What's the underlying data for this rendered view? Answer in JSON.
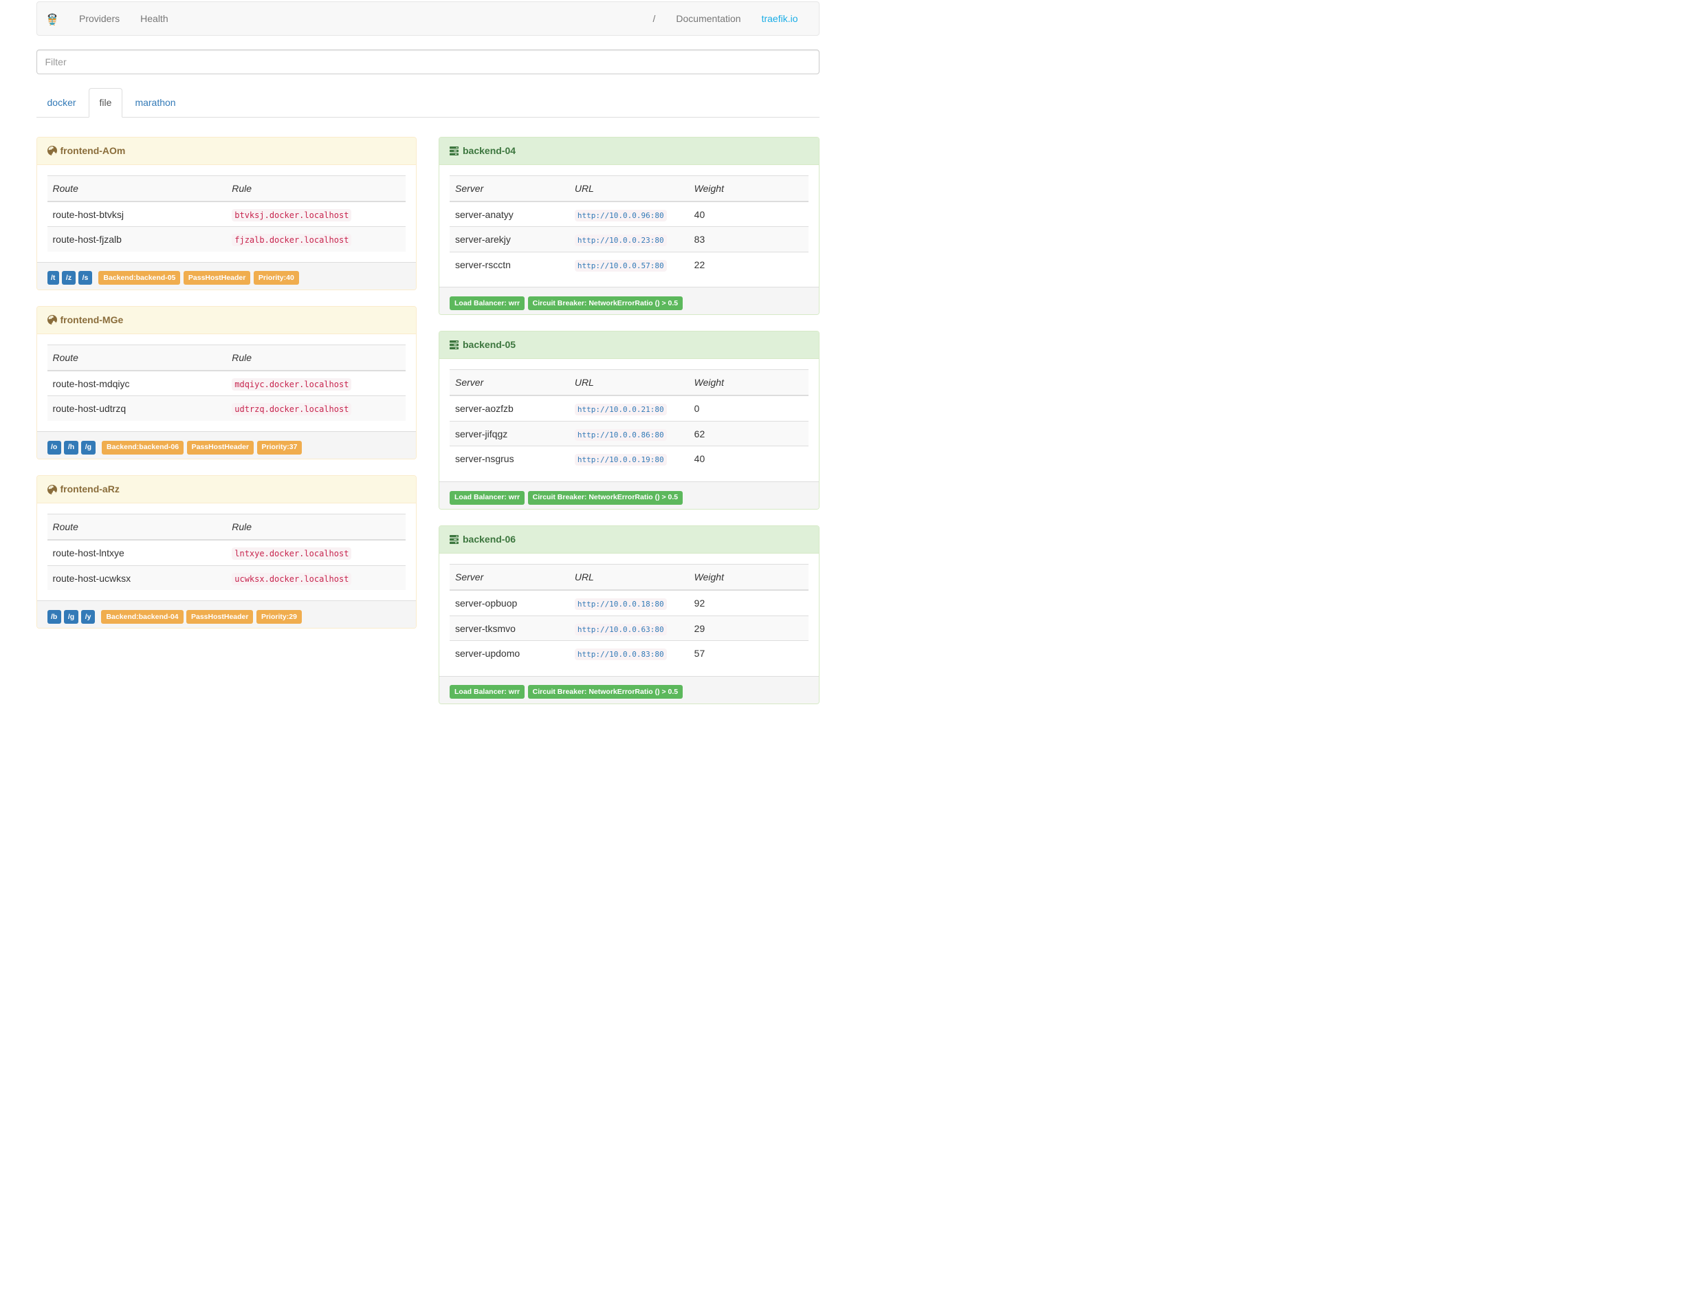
{
  "navbar": {
    "brand_icon": "traefik-gopher-logo",
    "links": [
      {
        "label": "Providers"
      },
      {
        "label": "Health"
      }
    ],
    "right_links": [
      {
        "label": "/"
      },
      {
        "label": "Documentation"
      },
      {
        "label": "traefik.io"
      }
    ]
  },
  "filter": {
    "placeholder": "Filter"
  },
  "tabs": [
    {
      "label": "docker",
      "active": false
    },
    {
      "label": "file",
      "active": true
    },
    {
      "label": "marathon",
      "active": false
    }
  ],
  "frontends": [
    {
      "title": "frontend-AOm",
      "columns": [
        "Route",
        "Rule"
      ],
      "rows": [
        {
          "route": "route-host-btvksj",
          "rule": "btvksj.docker.localhost"
        },
        {
          "route": "route-host-fjzalb",
          "rule": "fjzalb.docker.localhost"
        }
      ],
      "path_tags": [
        "/t",
        "/z",
        "/s"
      ],
      "info_tags": [
        "Backend:backend-05",
        "PassHostHeader",
        "Priority:40"
      ]
    },
    {
      "title": "frontend-MGe",
      "columns": [
        "Route",
        "Rule"
      ],
      "rows": [
        {
          "route": "route-host-mdqiyc",
          "rule": "mdqiyc.docker.localhost"
        },
        {
          "route": "route-host-udtrzq",
          "rule": "udtrzq.docker.localhost"
        }
      ],
      "path_tags": [
        "/o",
        "/h",
        "/g"
      ],
      "info_tags": [
        "Backend:backend-06",
        "PassHostHeader",
        "Priority:37"
      ]
    },
    {
      "title": "frontend-aRz",
      "columns": [
        "Route",
        "Rule"
      ],
      "rows": [
        {
          "route": "route-host-lntxye",
          "rule": "lntxye.docker.localhost"
        },
        {
          "route": "route-host-ucwksx",
          "rule": "ucwksx.docker.localhost"
        }
      ],
      "path_tags": [
        "/b",
        "/g",
        "/y"
      ],
      "info_tags": [
        "Backend:backend-04",
        "PassHostHeader",
        "Priority:29"
      ]
    }
  ],
  "backends": [
    {
      "title": "backend-04",
      "columns": [
        "Server",
        "URL",
        "Weight"
      ],
      "rows": [
        {
          "server": "server-anatyy",
          "url": "http://10.0.0.96:80",
          "weight": "40"
        },
        {
          "server": "server-arekjy",
          "url": "http://10.0.0.23:80",
          "weight": "83"
        },
        {
          "server": "server-rscctn",
          "url": "http://10.0.0.57:80",
          "weight": "22"
        }
      ],
      "info_tags": [
        "Load Balancer: wrr",
        "Circuit Breaker: NetworkErrorRatio () > 0.5"
      ]
    },
    {
      "title": "backend-05",
      "columns": [
        "Server",
        "URL",
        "Weight"
      ],
      "rows": [
        {
          "server": "server-aozfzb",
          "url": "http://10.0.0.21:80",
          "weight": "0"
        },
        {
          "server": "server-jifqgz",
          "url": "http://10.0.0.86:80",
          "weight": "62"
        },
        {
          "server": "server-nsgrus",
          "url": "http://10.0.0.19:80",
          "weight": "40"
        }
      ],
      "info_tags": [
        "Load Balancer: wrr",
        "Circuit Breaker: NetworkErrorRatio () > 0.5"
      ]
    },
    {
      "title": "backend-06",
      "columns": [
        "Server",
        "URL",
        "Weight"
      ],
      "rows": [
        {
          "server": "server-opbuop",
          "url": "http://10.0.0.18:80",
          "weight": "92"
        },
        {
          "server": "server-tksmvo",
          "url": "http://10.0.0.63:80",
          "weight": "29"
        },
        {
          "server": "server-updomo",
          "url": "http://10.0.0.83:80",
          "weight": "57"
        }
      ],
      "info_tags": [
        "Load Balancer: wrr",
        "Circuit Breaker: NetworkErrorRatio () > 0.5"
      ]
    }
  ],
  "colors": {
    "accent_primary": "#337ab7",
    "label_warning": "#f0ad4e",
    "label_success": "#5cb85c",
    "frontend_heading_bg": "#fcf8e3",
    "frontend_heading_text": "#8a6d3b",
    "backend_heading_bg": "#dff0d8",
    "backend_heading_text": "#3c763e",
    "code_text": "#c7254e",
    "code_bg": "#f9f2f4",
    "traefik_link": "#1aade6",
    "navbar_bg": "#f8f8f8",
    "navbar_text": "#777777"
  }
}
